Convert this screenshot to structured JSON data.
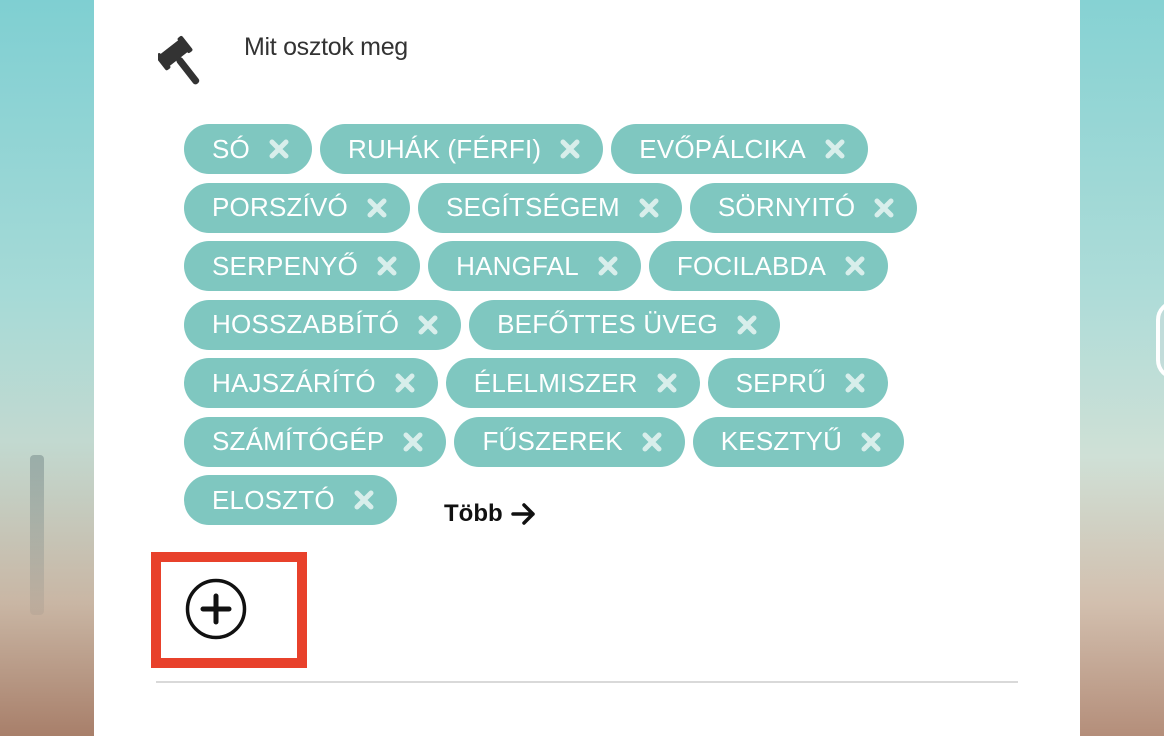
{
  "section": {
    "title": "Mit osztok meg",
    "icon": "gavel-icon"
  },
  "tags": [
    [
      "SÓ",
      "RUHÁK (FÉRFI)",
      "EVŐPÁLCIKA"
    ],
    [
      "PORSZÍVÓ",
      "SEGÍTSÉGEM",
      "SÖRNYITÓ"
    ],
    [
      "SERPENYŐ",
      "HANGFAL",
      "FOCILABDA"
    ],
    [
      "HOSSZABBÍTÓ",
      "BEFŐTTES ÜVEG"
    ],
    [
      "HAJSZÁRÍTÓ",
      "ÉLELMISZER",
      "SEPRŰ"
    ],
    [
      "SZÁMÍTÓGÉP",
      "FŰSZEREK",
      "KESZTYŰ"
    ],
    [
      "ELOSZTÓ"
    ]
  ],
  "more": {
    "label": "Több",
    "icon": "arrow-right-icon"
  },
  "add": {
    "icon": "plus-circle-icon"
  },
  "colors": {
    "tag_background": "#7fc7c0",
    "tag_text": "#ffffff",
    "tag_remove_icon": "#d8eeeb",
    "highlight_border": "#e8412b"
  }
}
